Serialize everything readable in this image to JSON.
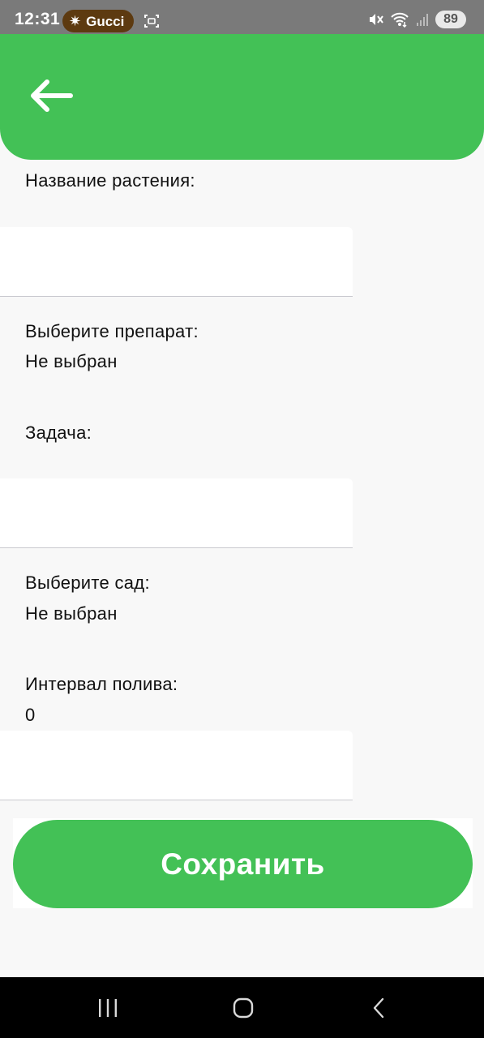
{
  "status_bar": {
    "time": "12:31",
    "notification_label": "Gucci",
    "battery": "89",
    "icons": [
      "spark-icon",
      "screenshot-icon",
      "mute-icon",
      "wifi-icon",
      "signal-icon",
      "battery-icon"
    ]
  },
  "app_bar": {
    "back_icon": "arrow-left-icon",
    "color": "#43c156"
  },
  "form": {
    "plant_name_label": "Название растения:",
    "plant_name_value": "",
    "preparation_label": "Выберите препарат:",
    "preparation_value": "Не выбран",
    "task_label": "Задача:",
    "task_value": "",
    "garden_label": "Выберите сад:",
    "garden_value": "Не выбран",
    "watering_interval_label": "Интервал полива:",
    "watering_interval_value": "0",
    "watering_interval_input": ""
  },
  "save_label": "Сохранить",
  "nav_bar": {
    "icons": [
      "recent-apps-icon",
      "home-icon",
      "back-icon"
    ]
  }
}
